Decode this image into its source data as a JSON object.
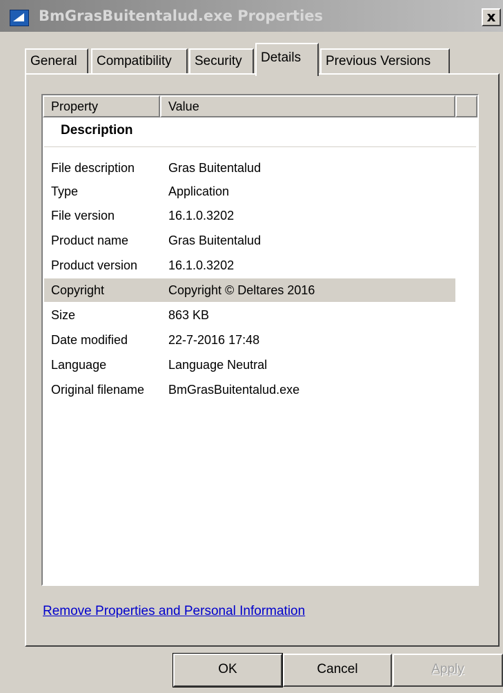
{
  "window": {
    "title": "BmGrasBuitentalud.exe Properties",
    "close_label": "x"
  },
  "tabs": [
    {
      "label": "General",
      "active": false
    },
    {
      "label": "Compatibility",
      "active": false
    },
    {
      "label": "Security",
      "active": false
    },
    {
      "label": "Details",
      "active": true
    },
    {
      "label": "Previous Versions",
      "active": false
    }
  ],
  "list": {
    "columns": [
      "Property",
      "Value"
    ],
    "section": "Description",
    "rows": [
      {
        "property": "File description",
        "value": "Gras Buitentalud"
      },
      {
        "property": "Type",
        "value": "Application"
      },
      {
        "property": "File version",
        "value": "16.1.0.3202"
      },
      {
        "property": "Product name",
        "value": "Gras Buitentalud"
      },
      {
        "property": "Product version",
        "value": "16.1.0.3202"
      },
      {
        "property": "Copyright",
        "value": "Copyright © Deltares 2016",
        "selected": true
      },
      {
        "property": "Size",
        "value": "863 KB"
      },
      {
        "property": "Date modified",
        "value": "22-7-2016 17:48"
      },
      {
        "property": "Language",
        "value": "Language Neutral"
      },
      {
        "property": "Original filename",
        "value": "BmGrasBuitentalud.exe"
      }
    ]
  },
  "link": "Remove Properties and Personal Information",
  "buttons": {
    "ok": "OK",
    "cancel": "Cancel",
    "apply": "Apply"
  },
  "colors": {
    "face": "#d4d0c8",
    "link": "#0000cc",
    "selection": "#d4d0c8"
  }
}
